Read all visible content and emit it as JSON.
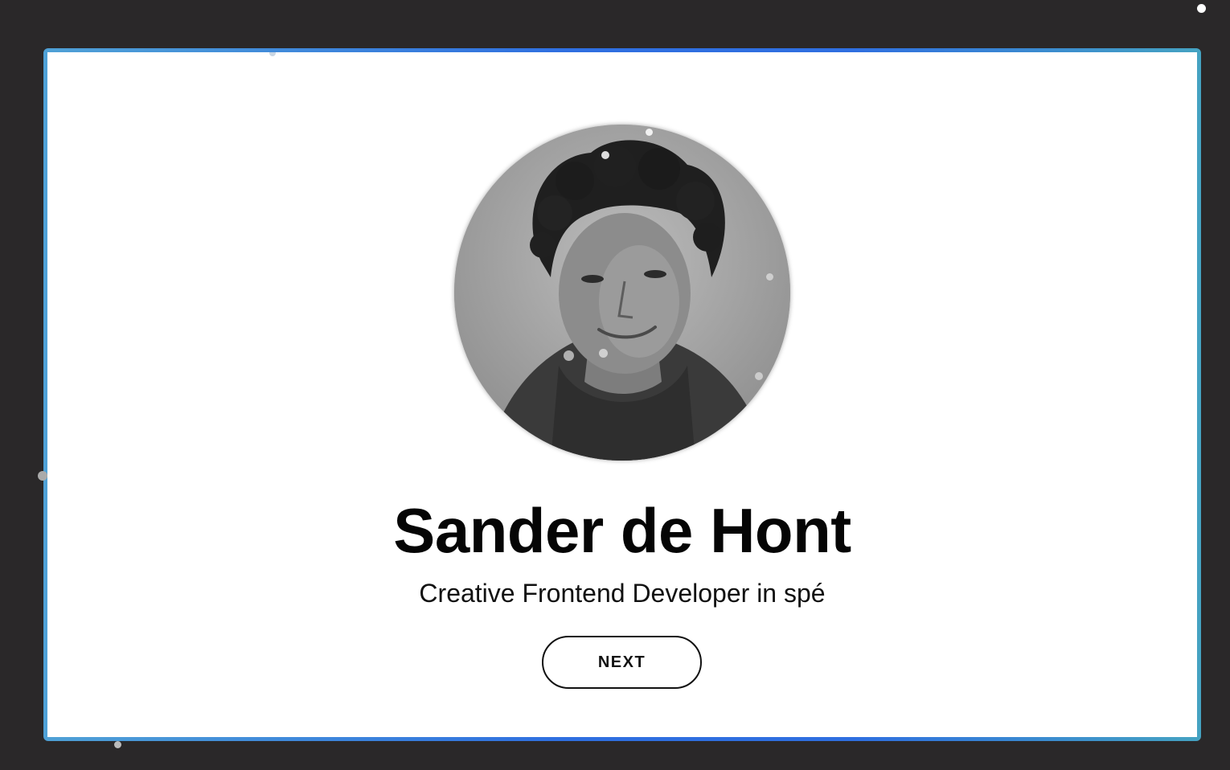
{
  "profile": {
    "name": "Sander de Hont",
    "tagline": "Creative Frontend Developer in spé",
    "avatar_icon": "portrait-photo-grayscale"
  },
  "actions": {
    "next_label": "NEXT"
  },
  "colors": {
    "background": "#2a2829",
    "card": "#ffffff",
    "border_gradient_start": "#4fa1d6",
    "border_gradient_mid": "#2f6fe0",
    "border_gradient_end": "#45a3c2",
    "text": "#050505"
  }
}
